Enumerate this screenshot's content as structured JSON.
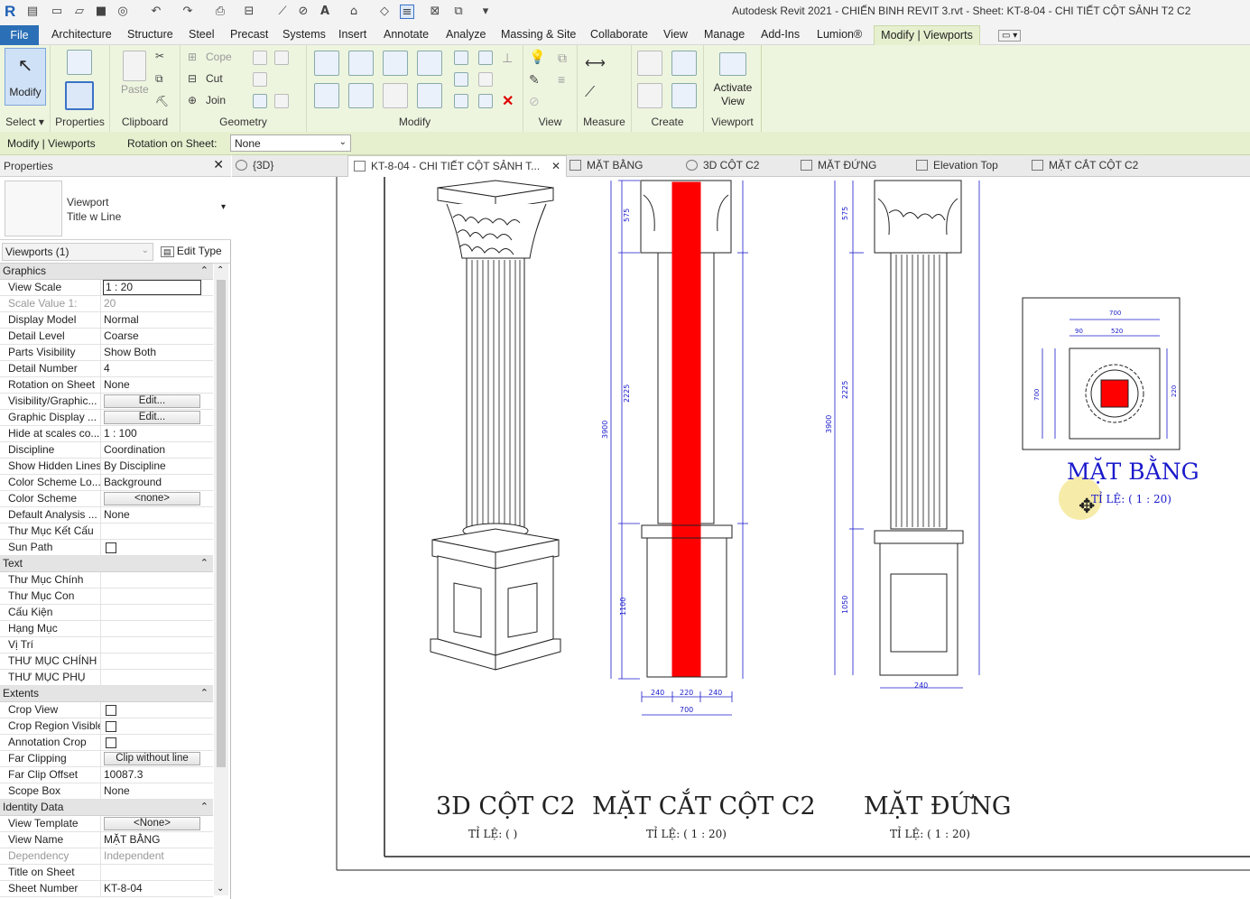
{
  "app": {
    "window_title": "Autodesk Revit 2021 - CHIẾN BINH REVIT 3.rvt - Sheet: KT-8-04 - CHI TIẾT CỘT SẢNH T2 C2"
  },
  "menu": {
    "file": "File",
    "tabs": [
      "Architecture",
      "Structure",
      "Steel",
      "Precast",
      "Systems",
      "Insert",
      "Annotate",
      "Analyze",
      "Massing & Site",
      "Collaborate",
      "View",
      "Manage",
      "Add-Ins",
      "Lumion®"
    ],
    "context_tab": "Modify | Viewports"
  },
  "ribbon": {
    "modify_label": "Modify",
    "properties_label": "Properties",
    "paste_label": "Paste",
    "cope_label": "Cope",
    "cut_label": "Cut",
    "join_label": "Join",
    "activate_view_label": "Activate View",
    "groups": {
      "select": "Select",
      "properties": "Properties",
      "clipboard": "Clipboard",
      "geometry": "Geometry",
      "modify": "Modify",
      "view": "View",
      "measure": "Measure",
      "create": "Create",
      "viewport": "Viewport"
    }
  },
  "options_bar": {
    "context": "Modify | Viewports",
    "rotation_label": "Rotation on Sheet:",
    "rotation_value": "None"
  },
  "properties_panel": {
    "title": "Properties",
    "type_line1": "Viewport",
    "type_line2": "Title w Line",
    "selector": "Viewports (1)",
    "edit_type": "Edit Type",
    "sections": [
      {
        "name": "Graphics",
        "rows": [
          {
            "k": "View Scale",
            "v": "1 : 20",
            "kind": "input"
          },
          {
            "k": "Scale Value    1:",
            "v": "20",
            "kind": "dim"
          },
          {
            "k": "Display Model",
            "v": "Normal"
          },
          {
            "k": "Detail Level",
            "v": "Coarse"
          },
          {
            "k": "Parts Visibility",
            "v": "Show Both"
          },
          {
            "k": "Detail Number",
            "v": "4"
          },
          {
            "k": "Rotation on Sheet",
            "v": "None"
          },
          {
            "k": "Visibility/Graphic...",
            "v": "Edit...",
            "kind": "button"
          },
          {
            "k": "Graphic Display ...",
            "v": "Edit...",
            "kind": "button"
          },
          {
            "k": "Hide at scales co...",
            "v": "1 : 100"
          },
          {
            "k": "Discipline",
            "v": "Coordination"
          },
          {
            "k": "Show Hidden Lines",
            "v": "By Discipline"
          },
          {
            "k": "Color Scheme Lo...",
            "v": "Background"
          },
          {
            "k": "Color Scheme",
            "v": "<none>",
            "kind": "button"
          },
          {
            "k": "Default Analysis ...",
            "v": "None"
          },
          {
            "k": "Thư Mục Kết Cấu",
            "v": ""
          },
          {
            "k": "Sun Path",
            "v": "",
            "kind": "check"
          }
        ]
      },
      {
        "name": "Text",
        "rows": [
          {
            "k": "Thư Mục Chính",
            "v": ""
          },
          {
            "k": "Thư Mục Con",
            "v": ""
          },
          {
            "k": "Cấu Kiện",
            "v": ""
          },
          {
            "k": "Hạng Mục",
            "v": ""
          },
          {
            "k": "Vị Trí",
            "v": ""
          },
          {
            "k": "THƯ MỤC CHÍNH",
            "v": ""
          },
          {
            "k": "THƯ MỤC PHỤ",
            "v": ""
          }
        ]
      },
      {
        "name": "Extents",
        "rows": [
          {
            "k": "Crop View",
            "v": "",
            "kind": "check"
          },
          {
            "k": "Crop Region Visible",
            "v": "",
            "kind": "check"
          },
          {
            "k": "Annotation Crop",
            "v": "",
            "kind": "check"
          },
          {
            "k": "Far Clipping",
            "v": "Clip without line",
            "kind": "button"
          },
          {
            "k": "Far Clip Offset",
            "v": "10087.3"
          },
          {
            "k": "Scope Box",
            "v": "None"
          }
        ]
      },
      {
        "name": "Identity Data",
        "rows": [
          {
            "k": "View Template",
            "v": "<None>",
            "kind": "button"
          },
          {
            "k": "View Name",
            "v": "MẶT BẰNG"
          },
          {
            "k": "Dependency",
            "v": "Independent",
            "kind": "dim"
          },
          {
            "k": "Title on Sheet",
            "v": ""
          },
          {
            "k": "Sheet Number",
            "v": "KT-8-04"
          }
        ]
      }
    ]
  },
  "doc_tabs": [
    {
      "label": "{3D}",
      "active": false
    },
    {
      "label": "KT-8-04 - CHI TIẾT CỘT SẢNH T...",
      "active": true
    },
    {
      "label": "MẶT BẰNG",
      "active": false
    },
    {
      "label": "3D CỘT C2",
      "active": false
    },
    {
      "label": "MẶT ĐỨNG",
      "active": false
    },
    {
      "label": "Elevation Top",
      "active": false
    },
    {
      "label": "MẶT CẮT CỘT C2",
      "active": false
    }
  ],
  "sheet": {
    "views": [
      {
        "title": "3D CỘT C2",
        "scale": "TỈ LỆ: ( )"
      },
      {
        "title": "MẶT CẮT CỘT C2",
        "scale": "TỈ LỆ: ( 1 : 20)"
      },
      {
        "title": "MẶT ĐỨNG",
        "scale": "TỈ LỆ: ( 1 : 20)"
      },
      {
        "title": "MẶT BẰNG",
        "scale": "TỈ LỆ: ( 1 : 20)"
      }
    ],
    "dims_section": [
      "575",
      "2225",
      "3900",
      "1100",
      "240",
      "220",
      "240",
      "700"
    ],
    "dims_elev": [
      "575",
      "2225",
      "3900",
      "1050",
      "240"
    ],
    "dims_plan": [
      "700",
      "520",
      "90",
      "220",
      "700"
    ]
  },
  "colors": {
    "context_green": "#eef5df",
    "file_blue": "#2b6fb6",
    "section_red": "#ff0000",
    "dim_blue": "#1a1acc"
  }
}
